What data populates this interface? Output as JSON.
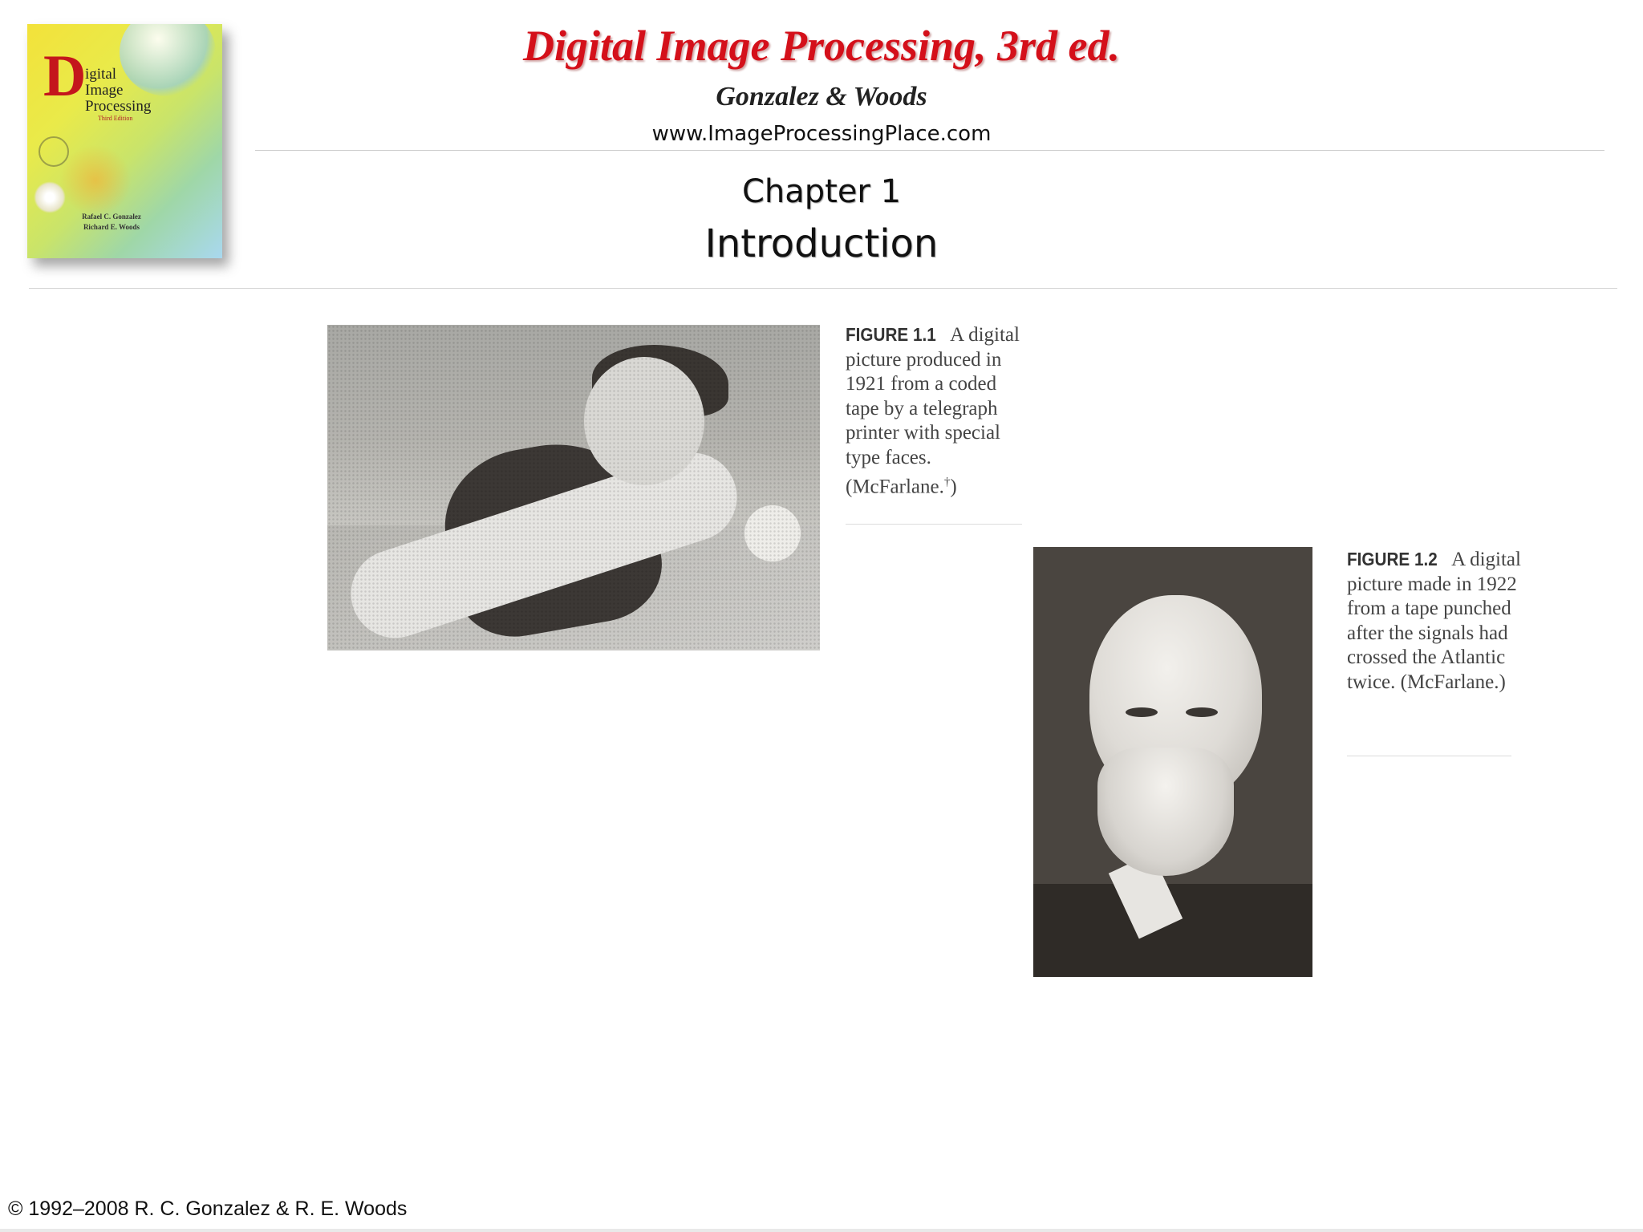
{
  "cover": {
    "initial": "D",
    "line1": "igital",
    "line2": "Image",
    "line3": "Processing",
    "edition": "Third Edition",
    "author1": "Rafael C. Gonzalez",
    "author2": "Richard E. Woods"
  },
  "header": {
    "title": "Digital Image Processing, 3rd ed.",
    "authors": "Gonzalez & Woods",
    "url": "www.ImageProcessingPlace.com"
  },
  "chapter": {
    "number": "Chapter 1",
    "title": "Introduction"
  },
  "figures": [
    {
      "label": "FIGURE 1.1",
      "text": "A digital picture produced in 1921 from a coded tape by a telegraph printer with special type faces. (McFarlane.",
      "mark": "†",
      "close": ")"
    },
    {
      "label": "FIGURE 1.2",
      "text": "A digital picture made in 1922 from a tape punched after the signals had crossed the Atlantic twice. (McFarlane.)"
    }
  ],
  "footer": {
    "copyright": "© 1992–2008  R. C. Gonzalez & R. E. Woods"
  }
}
